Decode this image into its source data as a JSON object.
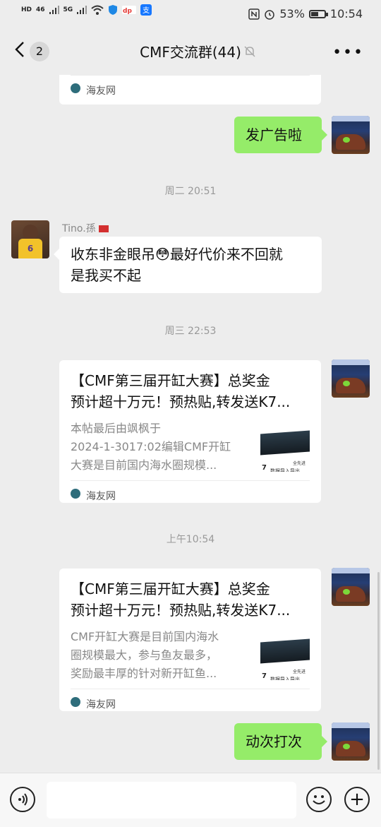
{
  "status_bar": {
    "hd1": "HD",
    "net1": "46",
    "net2": "5G",
    "battery_percent": "53%",
    "battery_level": 0.53,
    "time": "10:54"
  },
  "header": {
    "unread_badge": "2",
    "title": "CMF交流群(44)"
  },
  "messages": {
    "m1_source": "海友网",
    "m2_text": "发广告啦",
    "time1": "周二 20:51",
    "m3_sender": "Tino.孫",
    "m3_line1": "收东非金眼吊😳最好代价来不回就",
    "m3_line2": "是我买不起",
    "time2": "周三 22:53",
    "card1": {
      "title_line1": "【CMF第三届开缸大赛】总奖金",
      "title_line2": "预计超十万元！预热贴,转发送K7...",
      "desc_line1": "本帖最后由飒枫于",
      "desc_line2": "2024-1-3017:02编辑CMF开缸",
      "desc_line3": "大赛是目前国内海水圈规模...",
      "thumb_num": "7",
      "thumb_text": "数据导入导出",
      "thumb_tiny": "全先进",
      "source": "海友网"
    },
    "time3": "上午10:54",
    "card2": {
      "title_line1": "【CMF第三届开缸大赛】总奖金",
      "title_line2": "预计超十万元！预热贴,转发送K7...",
      "desc_line1": "CMF开缸大赛是目前国内海水",
      "desc_line2": "圈规模最大，参与鱼友最多，",
      "desc_line3": "奖励最丰厚的针对新开缸鱼...",
      "thumb_num": "7",
      "thumb_text": "数据导入导出",
      "thumb_tiny": "全先进",
      "source": "海友网"
    },
    "m_last": "动次打次"
  }
}
